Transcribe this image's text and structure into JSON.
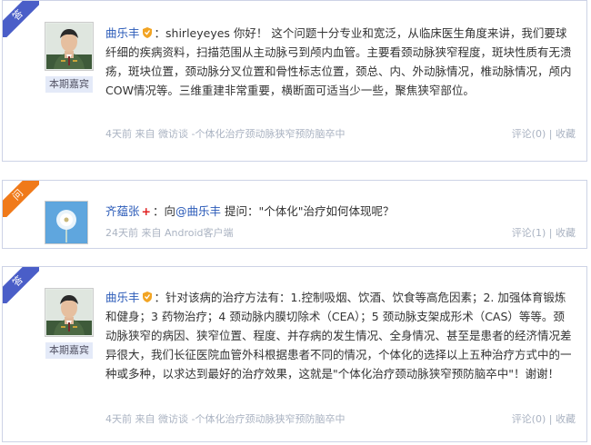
{
  "cards": [
    {
      "ribbon": "答",
      "name": "曲乐丰",
      "badge": "本期嘉宾",
      "text": "：shirleyeyes 你好！ 这个问题十分专业和宽泛，从临床医生角度来讲，我们要球纤细的疾病资料，扫描范围从主动脉弓到颅内血管。主要看颈动脉狭窄程度，斑块性质有无溃疡，斑块位置，颈动脉分叉位置和骨性标志位置，颈总、内、外动脉情况，椎动脉情况，颅内COW情况等。三维重建非常重要，横断面可适当少一些，聚焦狭窄部位。",
      "time": "4天前",
      "from": "来自",
      "source": "微访谈 -个体化治疗颈动脉狭窄预防脑卒中",
      "comment": "评论(0)",
      "sep": "|",
      "fav": "收藏"
    },
    {
      "ribbon": "问",
      "name": "齐蕴张",
      "plus": "+",
      "prefix": "：向",
      "mention": "@曲乐丰",
      "text": " 提问：\"个体化\"治疗如何体现呢？",
      "time": "24天前",
      "from": "来自",
      "source": "Android客户端",
      "comment": "评论(1)",
      "sep": "|",
      "fav": "收藏"
    },
    {
      "ribbon": "答",
      "name": "曲乐丰",
      "badge": "本期嘉宾",
      "text": "：针对该病的治疗方法有：1.控制吸烟、饮酒、饮食等高危因素；2. 加强体育锻炼和健身；3 药物治疗；4 颈动脉内膜切除术（CEA）；5 颈动脉支架成形术（CAS）等等。颈动脉狭窄的病因、狭窄位置、程度、并存病的发生情况、全身情况、甚至是患者的经济情况差异很大，我们长征医院血管外科根据患者不同的情况，个体化的选择以上五种治疗方式中的一种或多种，以求达到最好的治疗效果，这就是\"个体化治疗颈动脉狭窄预防脑卒中\"！谢谢！",
      "time": "4天前",
      "from": "来自",
      "source": "微访谈 -个体化治疗颈动脉狭窄预防脑卒中",
      "comment": "评论(0)",
      "sep": "|",
      "fav": "收藏"
    }
  ],
  "colors": {
    "answer_ribbon": "#4a5ec8",
    "question_ribbon": "#f07a1a",
    "link": "#2a5ab8",
    "meta": "#aab3c2"
  },
  "icons": {
    "vip": "vip-badge-icon",
    "avatar_doctor": "doctor-avatar",
    "avatar_dandelion": "dandelion-avatar"
  }
}
